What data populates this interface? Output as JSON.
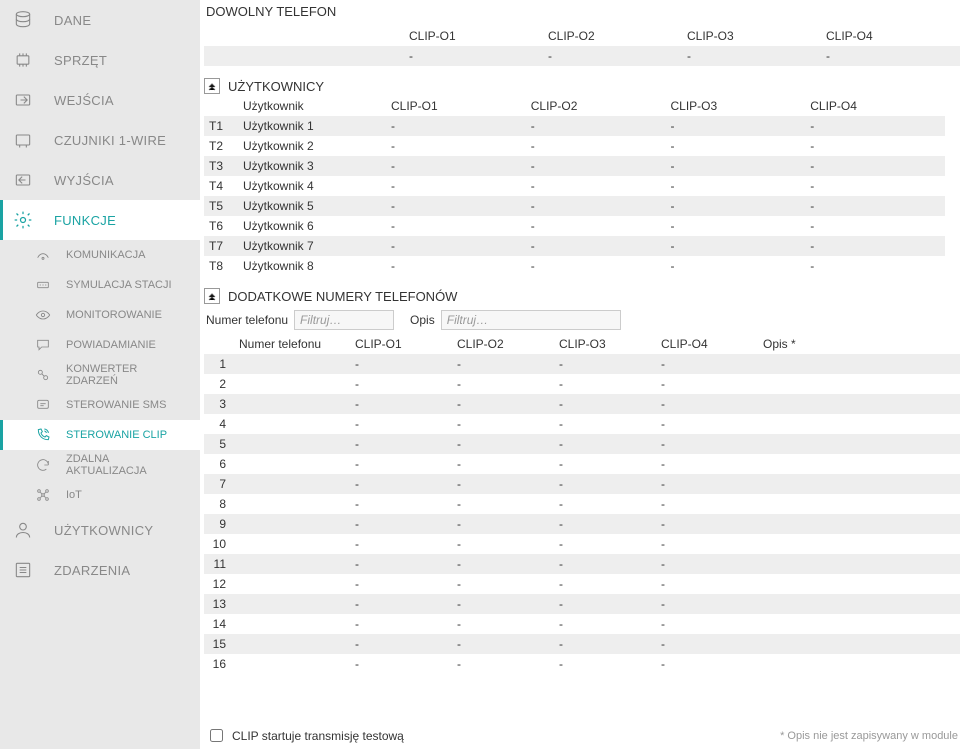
{
  "sidebar": {
    "items": [
      {
        "label": "DANE"
      },
      {
        "label": "SPRZĘT"
      },
      {
        "label": "WEJŚCIA"
      },
      {
        "label": "CZUJNIKI 1-WIRE"
      },
      {
        "label": "WYJŚCIA"
      },
      {
        "label": "FUNKCJE"
      },
      {
        "label": "UŻYTKOWNICY"
      },
      {
        "label": "ZDARZENIA"
      }
    ],
    "subitems": [
      {
        "label": "KOMUNIKACJA"
      },
      {
        "label": "SYMULACJA STACJI"
      },
      {
        "label": "MONITOROWANIE"
      },
      {
        "label": "POWIADAMIANIE"
      },
      {
        "label": "KONWERTER ZDARZEŃ"
      },
      {
        "label": "STEROWANIE SMS"
      },
      {
        "label": "STEROWANIE CLIP"
      },
      {
        "label": "ZDALNA AKTUALIZACJA"
      },
      {
        "label": "IoT"
      }
    ]
  },
  "sections": {
    "dowolny": {
      "title": "DOWOLNY TELEFON",
      "cols": [
        "CLIP-O1",
        "CLIP-O2",
        "CLIP-O3",
        "CLIP-O4"
      ],
      "row": [
        "-",
        "-",
        "-",
        "-"
      ]
    },
    "users": {
      "title": "UŻYTKOWNICY",
      "cols": [
        "Użytkownik",
        "CLIP-O1",
        "CLIP-O2",
        "CLIP-O3",
        "CLIP-O4"
      ],
      "rows": [
        {
          "idx": "T1",
          "name": "Użytkownik 1",
          "c1": "-",
          "c2": "-",
          "c3": "-",
          "c4": "-"
        },
        {
          "idx": "T2",
          "name": "Użytkownik 2",
          "c1": "-",
          "c2": "-",
          "c3": "-",
          "c4": "-"
        },
        {
          "idx": "T3",
          "name": "Użytkownik 3",
          "c1": "-",
          "c2": "-",
          "c3": "-",
          "c4": "-"
        },
        {
          "idx": "T4",
          "name": "Użytkownik 4",
          "c1": "-",
          "c2": "-",
          "c3": "-",
          "c4": "-"
        },
        {
          "idx": "T5",
          "name": "Użytkownik 5",
          "c1": "-",
          "c2": "-",
          "c3": "-",
          "c4": "-"
        },
        {
          "idx": "T6",
          "name": "Użytkownik 6",
          "c1": "-",
          "c2": "-",
          "c3": "-",
          "c4": "-"
        },
        {
          "idx": "T7",
          "name": "Użytkownik 7",
          "c1": "-",
          "c2": "-",
          "c3": "-",
          "c4": "-"
        },
        {
          "idx": "T8",
          "name": "Użytkownik 8",
          "c1": "-",
          "c2": "-",
          "c3": "-",
          "c4": "-"
        }
      ]
    },
    "numbers": {
      "title": "DODATKOWE NUMERY TELEFONÓW",
      "filter1_label": "Numer telefonu",
      "filter1_placeholder": "Filtruj…",
      "filter2_label": "Opis",
      "filter2_placeholder": "Filtruj…",
      "cols": [
        "Numer telefonu",
        "CLIP-O1",
        "CLIP-O2",
        "CLIP-O3",
        "CLIP-O4",
        "Opis *"
      ],
      "rows": [
        {
          "idx": "1",
          "num": "",
          "c1": "-",
          "c2": "-",
          "c3": "-",
          "c4": "-",
          "desc": ""
        },
        {
          "idx": "2",
          "num": "",
          "c1": "-",
          "c2": "-",
          "c3": "-",
          "c4": "-",
          "desc": ""
        },
        {
          "idx": "3",
          "num": "",
          "c1": "-",
          "c2": "-",
          "c3": "-",
          "c4": "-",
          "desc": ""
        },
        {
          "idx": "4",
          "num": "",
          "c1": "-",
          "c2": "-",
          "c3": "-",
          "c4": "-",
          "desc": ""
        },
        {
          "idx": "5",
          "num": "",
          "c1": "-",
          "c2": "-",
          "c3": "-",
          "c4": "-",
          "desc": ""
        },
        {
          "idx": "6",
          "num": "",
          "c1": "-",
          "c2": "-",
          "c3": "-",
          "c4": "-",
          "desc": ""
        },
        {
          "idx": "7",
          "num": "",
          "c1": "-",
          "c2": "-",
          "c3": "-",
          "c4": "-",
          "desc": ""
        },
        {
          "idx": "8",
          "num": "",
          "c1": "-",
          "c2": "-",
          "c3": "-",
          "c4": "-",
          "desc": ""
        },
        {
          "idx": "9",
          "num": "",
          "c1": "-",
          "c2": "-",
          "c3": "-",
          "c4": "-",
          "desc": ""
        },
        {
          "idx": "10",
          "num": "",
          "c1": "-",
          "c2": "-",
          "c3": "-",
          "c4": "-",
          "desc": ""
        },
        {
          "idx": "11",
          "num": "",
          "c1": "-",
          "c2": "-",
          "c3": "-",
          "c4": "-",
          "desc": ""
        },
        {
          "idx": "12",
          "num": "",
          "c1": "-",
          "c2": "-",
          "c3": "-",
          "c4": "-",
          "desc": ""
        },
        {
          "idx": "13",
          "num": "",
          "c1": "-",
          "c2": "-",
          "c3": "-",
          "c4": "-",
          "desc": ""
        },
        {
          "idx": "14",
          "num": "",
          "c1": "-",
          "c2": "-",
          "c3": "-",
          "c4": "-",
          "desc": ""
        },
        {
          "idx": "15",
          "num": "",
          "c1": "-",
          "c2": "-",
          "c3": "-",
          "c4": "-",
          "desc": ""
        },
        {
          "idx": "16",
          "num": "",
          "c1": "-",
          "c2": "-",
          "c3": "-",
          "c4": "-",
          "desc": ""
        }
      ]
    }
  },
  "footer": {
    "checkbox_label": "CLIP startuje transmisję testową",
    "note": "* Opis nie jest zapisywany w module"
  }
}
